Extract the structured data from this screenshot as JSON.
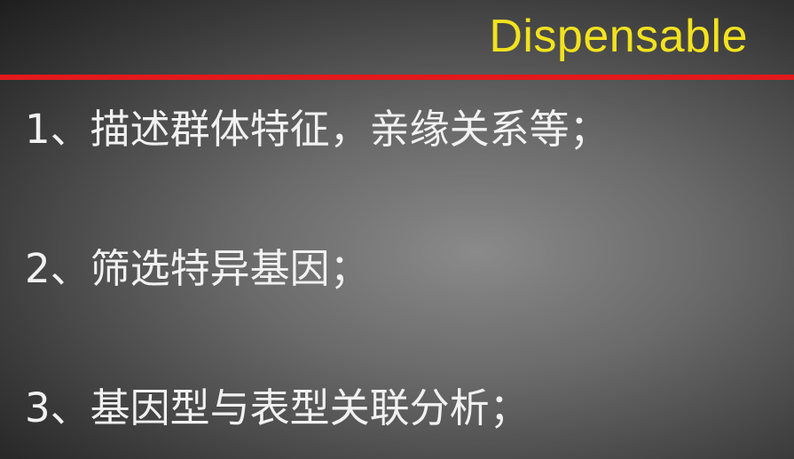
{
  "slide": {
    "title": "Dispensable",
    "items": [
      "1、描述群体特征，亲缘关系等；",
      "2、筛选特异基因；",
      "3、基因型与表型关联分析；"
    ]
  },
  "colors": {
    "title": "#f2e21e",
    "divider": "#e3191c",
    "text": "#f1f1f1",
    "background_center": "#8a8a8a",
    "background_edge": "#1e1e1e"
  }
}
